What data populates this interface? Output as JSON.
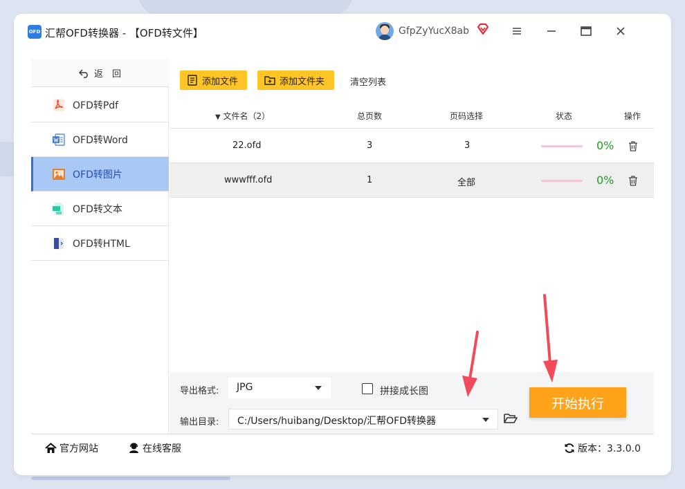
{
  "app": {
    "title": "汇帮OFD转换器 - 【OFD转文件】",
    "logo_text": "OFD",
    "username": "GfpZyYucX8ab"
  },
  "sidebar": {
    "back_label": "返　回",
    "items": [
      {
        "label": "OFD转Pdf",
        "icon": "pdf-icon",
        "active": false
      },
      {
        "label": "OFD转Word",
        "icon": "word-icon",
        "active": false
      },
      {
        "label": "OFD转图片",
        "icon": "image-icon",
        "active": true
      },
      {
        "label": "OFD转文本",
        "icon": "text-file-icon",
        "active": false
      },
      {
        "label": "OFD转HTML",
        "icon": "html-icon",
        "active": false
      }
    ]
  },
  "toolbar": {
    "add_file": "添加文件",
    "add_folder": "添加文件夹",
    "clear_list": "清空列表"
  },
  "table": {
    "headers": {
      "filename": "文件名（2）",
      "total_pages": "总页数",
      "page_select": "页码选择",
      "status": "状态",
      "action": "操作"
    },
    "rows": [
      {
        "filename": "22.ofd",
        "total_pages": "3",
        "page_select": "3",
        "progress": "0%"
      },
      {
        "filename": "wwwfff.ofd",
        "total_pages": "1",
        "page_select": "全部",
        "progress": "0%"
      }
    ]
  },
  "settings": {
    "format_label": "导出格式:",
    "format_value": "JPG",
    "stitch_label": "拼接成长图",
    "stitch_checked": false,
    "output_label": "输出目录:",
    "output_value": "C:/Users/huibang/Desktop/汇帮OFD转换器",
    "start_button": "开始执行"
  },
  "footer": {
    "website": "官方网站",
    "support": "在线客服",
    "version": "版本：3.3.0.0"
  },
  "colors": {
    "accent_yellow": "#ffc425",
    "start_orange": "#ffa31a",
    "active_nav": "#a9c8f4",
    "progress_green": "#19a319",
    "annotation_red": "#f04a5b"
  }
}
